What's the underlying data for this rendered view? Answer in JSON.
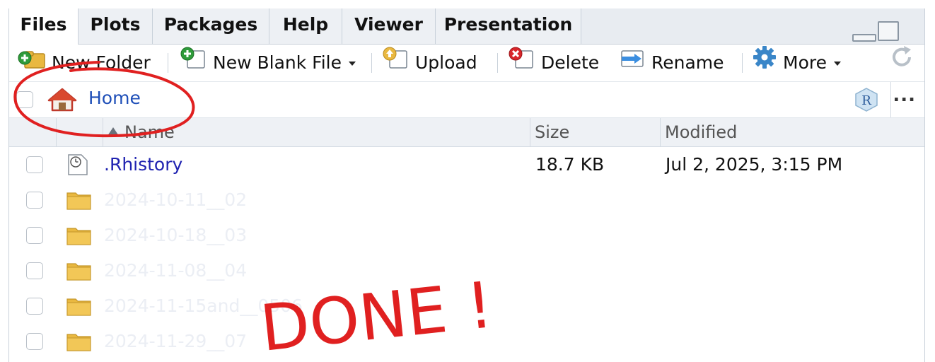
{
  "tabs": [
    "Files",
    "Plots",
    "Packages",
    "Help",
    "Viewer",
    "Presentation"
  ],
  "active_tab": "Files",
  "toolbar": {
    "new_folder": "New Folder",
    "new_blank_file": "New Blank File",
    "upload": "Upload",
    "delete": "Delete",
    "rename": "Rename",
    "more": "More"
  },
  "path": {
    "home": "Home",
    "more_menu": "..."
  },
  "columns": {
    "name": "Name",
    "size": "Size",
    "modified": "Modified"
  },
  "files": [
    {
      "name": ".Rhistory",
      "size": "18.7 KB",
      "modified": "Jul 2, 2025, 3:15 PM",
      "type": "history-file"
    },
    {
      "name": "2024-10-11__02",
      "size": "",
      "modified": "",
      "type": "folder"
    },
    {
      "name": "2024-10-18__03",
      "size": "",
      "modified": "",
      "type": "folder"
    },
    {
      "name": "2024-11-08__04",
      "size": "",
      "modified": "",
      "type": "folder"
    },
    {
      "name": "2024-11-15and__0506",
      "size": "",
      "modified": "",
      "type": "folder"
    },
    {
      "name": "2024-11-29__07",
      "size": "",
      "modified": "",
      "type": "folder"
    }
  ],
  "annotation": {
    "text": "DONE !",
    "color": "#e02020"
  },
  "colors": {
    "link": "#1f4fb8",
    "file_link": "#1f22b0",
    "tab_bg": "#e8ecf1",
    "annotation_red": "#e02020",
    "folder": "#e9b840"
  },
  "icons": {
    "new_folder": "new-folder-icon",
    "new_blank_file": "new-file-icon",
    "upload": "upload-icon",
    "delete": "delete-icon",
    "rename": "rename-icon",
    "more": "gear-icon",
    "refresh": "refresh-icon",
    "home": "home-icon",
    "r_project": "r-project-icon",
    "history": "history-file-icon",
    "folder": "folder-icon"
  }
}
